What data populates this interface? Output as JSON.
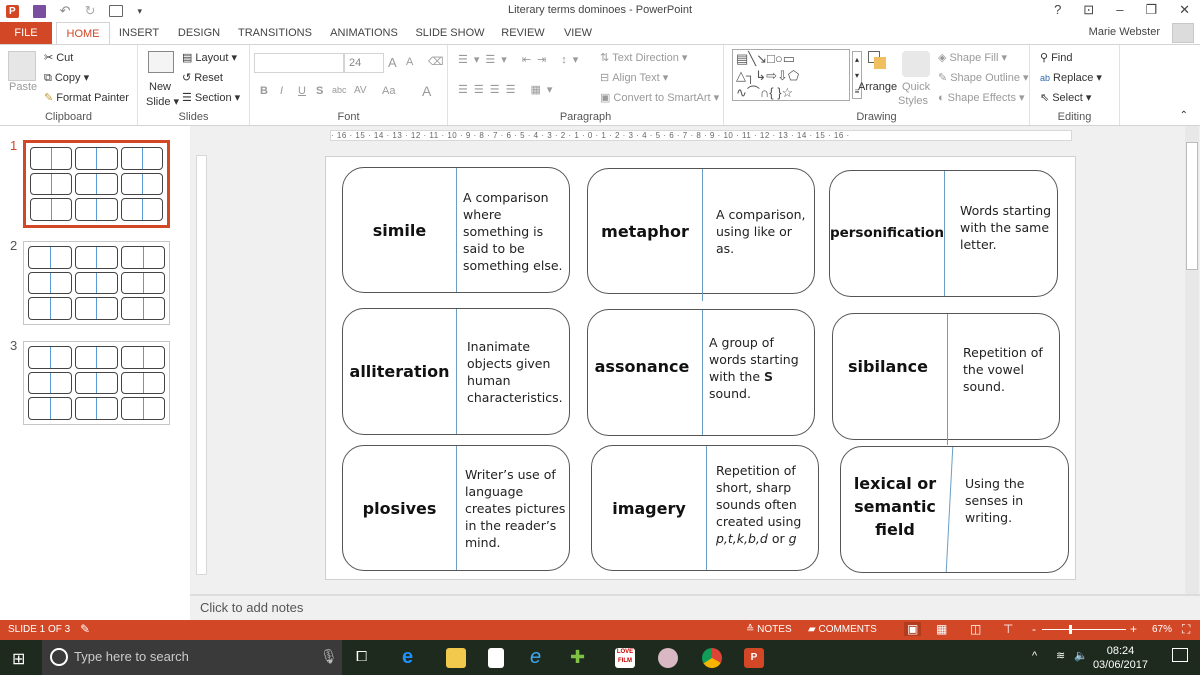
{
  "window": {
    "title": "Literary terms dominoes - PowerPoint",
    "controls": {
      "help": "?",
      "ribbon_display": "⊡",
      "minimize": "–",
      "restore": "❐",
      "close": "✕"
    },
    "user_name": "Marie Webster"
  },
  "quick_access": {
    "app_icon": "P",
    "save": "save-icon",
    "undo": "↶",
    "redo": "↻",
    "start_from_beginning": "slideshow-icon",
    "customize": "▾"
  },
  "tabs": [
    {
      "label": "FILE"
    },
    {
      "label": "HOME",
      "active": true
    },
    {
      "label": "INSERT"
    },
    {
      "label": "DESIGN"
    },
    {
      "label": "TRANSITIONS"
    },
    {
      "label": "ANIMATIONS"
    },
    {
      "label": "SLIDE SHOW"
    },
    {
      "label": "REVIEW"
    },
    {
      "label": "VIEW"
    }
  ],
  "ribbon": {
    "clipboard": {
      "label": "Clipboard",
      "paste": "Paste",
      "cut": "Cut",
      "copy": "Copy",
      "format_painter": "Format Painter"
    },
    "slides": {
      "label": "Slides",
      "new_slide_1": "New",
      "new_slide_2": "Slide",
      "layout": "Layout",
      "reset": "Reset",
      "section": "Section"
    },
    "font": {
      "label": "Font",
      "font_name": "",
      "font_size": "24",
      "bold": "B",
      "italic": "I",
      "underline": "U",
      "shadow": "S",
      "strikethrough": "abc",
      "spacing": "AV",
      "case": "Aa",
      "color": "A",
      "grow": "A",
      "shrink": "A"
    },
    "paragraph": {
      "label": "Paragraph",
      "text_direction": "Text Direction",
      "align_text": "Align Text",
      "convert_smartart": "Convert to SmartArt"
    },
    "drawing": {
      "label": "Drawing",
      "arrange": "Arrange",
      "quick_styles_1": "Quick",
      "quick_styles_2": "Styles",
      "shape_fill": "Shape Fill",
      "shape_outline": "Shape Outline",
      "shape_effects": "Shape Effects"
    },
    "editing": {
      "label": "Editing",
      "find": "Find",
      "replace": "Replace",
      "select": "Select"
    }
  },
  "ruler": {
    "horizontal": "· 16 · 15 · 14 · 13 · 12 · 11 · 10 · 9 · 8 · 7 · 6 · 5 · 4 · 3 · 2 · 1 · 0 · 1 · 2 · 3 · 4 · 5 · 6 · 7 · 8 · 9 · 10 · 11 · 12 · 13 · 14 · 15 · 16 ·"
  },
  "thumbnails": [
    {
      "number": "1",
      "selected": true
    },
    {
      "number": "2",
      "selected": false
    },
    {
      "number": "3",
      "selected": false
    }
  ],
  "slide": {
    "cards": [
      {
        "term": "simile",
        "definition": "A comparison where something is said to be something else."
      },
      {
        "term": "metaphor",
        "definition": "A comparison, using like or as."
      },
      {
        "term": "personification",
        "definition": "Words starting with the same letter."
      },
      {
        "term": "alliteration",
        "definition": "Inanimate objects given human characteristics."
      },
      {
        "term": "assonance",
        "definition_pre": "A group of words starting with the ",
        "definition_bold": "S",
        "definition_post": " sound."
      },
      {
        "term": "sibilance",
        "definition": "Repetition of the vowel sound."
      },
      {
        "term": "plosives",
        "definition": "Writer’s use of language creates pictures in the reader’s mind."
      },
      {
        "term": "imagery",
        "definition_pre": "Repetition of short, sharp sounds often created using ",
        "definition_italic": "p,t,k,b,d",
        "definition_mid": " or ",
        "definition_italic2": "g"
      },
      {
        "term": "lexical or semantic field",
        "definition": "Using the senses in writing."
      }
    ]
  },
  "notes": {
    "placeholder": "Click to add notes"
  },
  "status": {
    "slide_info": "SLIDE 1 OF 3",
    "notes": "NOTES",
    "comments": "COMMENTS",
    "zoom": "67%",
    "zoom_minus": "-",
    "zoom_plus": "+",
    "zoom_level_percent": 67
  },
  "taskbar": {
    "search_placeholder": "Type here to search",
    "time": "08:24",
    "date": "03/06/2017"
  }
}
